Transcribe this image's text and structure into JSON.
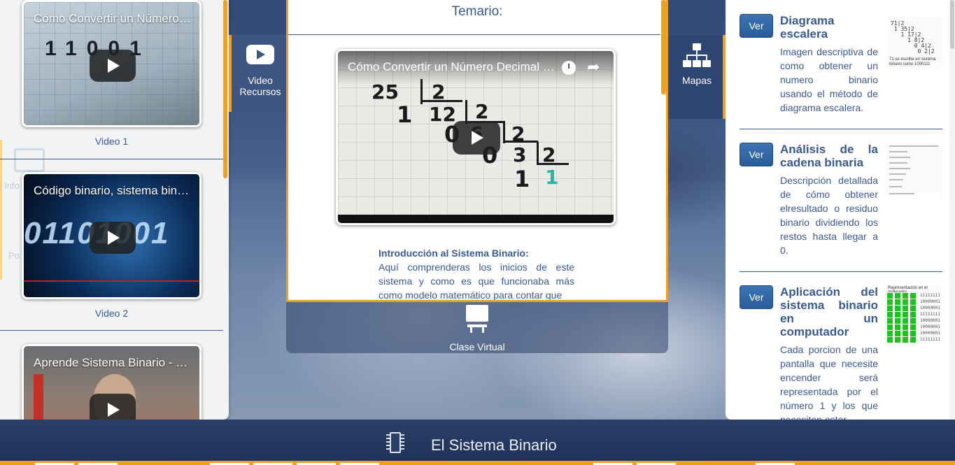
{
  "app": {
    "footer_title": "El Sistema Binario"
  },
  "left_panel": {
    "videos": [
      {
        "title": "Cómo Convertir un Número Decimal a Binario",
        "label": "Video 1"
      },
      {
        "title": "Código binario, sistema binario",
        "label": "Video 2"
      },
      {
        "title": "Aprende Sistema Binario - Explicación",
        "label": ""
      }
    ],
    "ghost_labels": [
      "Info",
      "Po"
    ]
  },
  "tabs": {
    "video_recursos": {
      "label_line1": "Video",
      "label_line2": "Recursos",
      "icon": "youtube-play-icon"
    },
    "clase_virtual": {
      "label": "Clase Virtual",
      "icon": "classroom-icon"
    },
    "mapas": {
      "label": "Mapas",
      "icon": "sitemap-icon"
    }
  },
  "center": {
    "heading": "Temario:",
    "video": {
      "title": "Cómo Convertir un Número Decimal a Binario",
      "math": [
        "25",
        "2",
        "1",
        "12",
        "2",
        "0",
        "6",
        "2",
        "0",
        "3",
        "2",
        "1",
        "1"
      ]
    },
    "intro": {
      "title": "Introducción al Sistema Binario:",
      "text": "Aquí comprenderas los inicios de este sistema y como es que funcionaba más como modelo matemático para contar que"
    }
  },
  "right_panel": {
    "items": [
      {
        "button": "Ver",
        "title": "Diagrama escalera",
        "description": "Imagen descriptiva de como obtener un numero binario usando el método de diagrama escalera.",
        "thumb_caption": "71 se escribe en sistema binario como 1000111"
      },
      {
        "button": "Ver",
        "title": "Análisis de la cadena binaria",
        "description": "Descripción detallada de cómo obtener elresultado o residuo binario dividiendo los restos hasta llegar a 0."
      },
      {
        "button": "Ver",
        "title": "Aplicación del sistema binario en un computador",
        "description": "Cada porcion de una pantalla que necesite encender será representada por el número 1 y los que necesiten estar",
        "thumb_caption": "Representación en el ordenador"
      }
    ]
  },
  "colors": {
    "accent": "#f0a020",
    "brand": "#3a5a90",
    "button": "#2a5d9a",
    "footer": "#2a3f68"
  }
}
